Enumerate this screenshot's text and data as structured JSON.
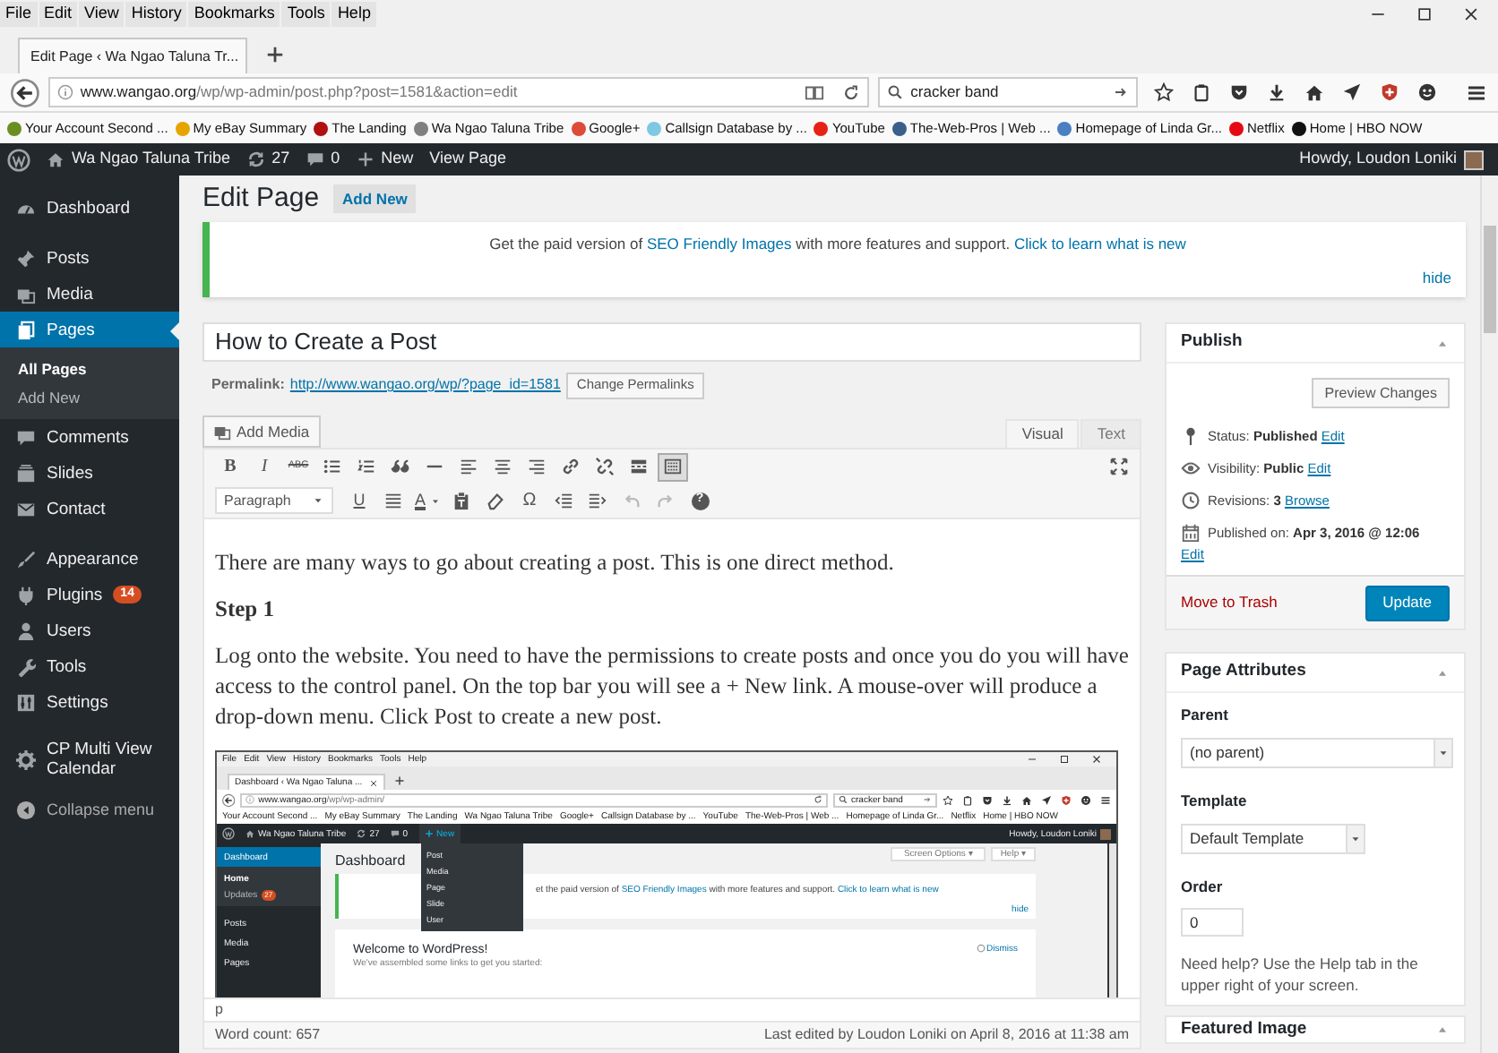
{
  "menu_bar": [
    "File",
    "Edit",
    "View",
    "History",
    "Bookmarks",
    "Tools",
    "Help"
  ],
  "browser_tab": {
    "title": "Edit Page ‹ Wa Ngao Taluna Tr..."
  },
  "address_bar": {
    "domain": "www.wangao.org",
    "path": "/wp/wp-admin/post.php?post=1581&action=edit"
  },
  "search_field": {
    "value": "cracker band"
  },
  "bookmarks": [
    {
      "label": "Your Account Second ...",
      "color": "#6b8e23"
    },
    {
      "label": "My eBay Summary",
      "color": "#e6a400"
    },
    {
      "label": "The Landing",
      "color": "#b01010"
    },
    {
      "label": "Wa Ngao Taluna Tribe",
      "color": "#808080"
    },
    {
      "label": "Google+",
      "color": "#dd4b39"
    },
    {
      "label": "Callsign Database by ...",
      "color": "#7ec8e3"
    },
    {
      "label": "YouTube",
      "color": "#e62117"
    },
    {
      "label": "The-Web-Pros | Web ...",
      "color": "#3a5f8a"
    },
    {
      "label": "Homepage of Linda Gr...",
      "color": "#4a7fc1"
    },
    {
      "label": "Netflix",
      "color": "#e50914"
    },
    {
      "label": "Home | HBO NOW",
      "color": "#111111"
    }
  ],
  "admin_bar": {
    "site": "Wa Ngao Taluna Tribe",
    "updates": "27",
    "comments": "0",
    "new": "New",
    "view": "View Page",
    "greeting": "Howdy, Loudon Loniki"
  },
  "sidebar": {
    "groups": [
      {
        "items": [
          {
            "kind": "dashboard",
            "label": "Dashboard",
            "selected": false
          }
        ]
      },
      {
        "items": [
          {
            "kind": "posts",
            "label": "Posts",
            "selected": false
          },
          {
            "kind": "media",
            "label": "Media",
            "selected": false
          },
          {
            "kind": "pages",
            "label": "Pages",
            "selected": true,
            "children": [
              {
                "label": "All Pages",
                "selected": true
              },
              {
                "label": "Add New",
                "selected": false
              }
            ]
          },
          {
            "kind": "comments",
            "label": "Comments",
            "selected": false
          },
          {
            "kind": "slides",
            "label": "Slides",
            "selected": false
          },
          {
            "kind": "contact",
            "label": "Contact",
            "selected": false
          }
        ]
      },
      {
        "items": [
          {
            "kind": "appearance",
            "label": "Appearance",
            "selected": false
          },
          {
            "kind": "plugins",
            "label": "Plugins",
            "selected": false,
            "badge": "14"
          },
          {
            "kind": "users",
            "label": "Users",
            "selected": false
          },
          {
            "kind": "tools",
            "label": "Tools",
            "selected": false
          },
          {
            "kind": "settings",
            "label": "Settings",
            "selected": false
          }
        ]
      },
      {
        "items": [
          {
            "kind": "calendar",
            "label": "CP Multi View Calendar",
            "selected": false
          }
        ]
      }
    ],
    "collapse": "Collapse menu"
  },
  "heading": "Edit Page",
  "add_new": "Add New",
  "notice": {
    "text": "Get the paid version of ",
    "link": "SEO Friendly Images",
    "text_2": " with more features and support. ",
    "link_2": "Click to learn what is new",
    "hide": "hide"
  },
  "title_field": {
    "value": "How to Create a Post"
  },
  "permalink": {
    "label": "Permalink:",
    "url": "http://www.wangao.org/wp/?page_id=1581",
    "button": "Change Permalinks"
  },
  "add_media": "Add Media",
  "editor_tabs": [
    {
      "label": "Visual",
      "selected": true
    },
    {
      "label": "Text",
      "selected": false
    }
  ],
  "toolbar": {
    "row_1": [
      {
        "kind": "bold",
        "glyph": "B"
      },
      {
        "kind": "italic",
        "glyph": "I"
      },
      {
        "kind": "strike",
        "glyph": "ABC"
      },
      {
        "kind": "bullets"
      },
      {
        "kind": "numbers"
      },
      {
        "kind": "quote"
      },
      {
        "kind": "hr"
      },
      {
        "kind": "align-left"
      },
      {
        "kind": "align-center"
      },
      {
        "kind": "align-right"
      },
      {
        "kind": "link"
      },
      {
        "kind": "unlink"
      },
      {
        "kind": "more"
      },
      {
        "kind": "toggle",
        "selected": true
      }
    ],
    "row_2": [
      {
        "kind": "format",
        "value": "Paragraph"
      },
      {
        "kind": "underline",
        "glyph": "U"
      },
      {
        "kind": "justify"
      },
      {
        "kind": "color",
        "glyph": "A"
      },
      {
        "kind": "paste"
      },
      {
        "kind": "eraser"
      },
      {
        "kind": "omega",
        "glyph": "Ω"
      },
      {
        "kind": "outdent"
      },
      {
        "kind": "indent"
      },
      {
        "kind": "undo"
      },
      {
        "kind": "redo"
      },
      {
        "kind": "help",
        "glyph": "?"
      }
    ]
  },
  "content": [
    {
      "kind": "p",
      "text": "There are many ways to go about creating a post. This is one direct method."
    },
    {
      "kind": "h",
      "text": "Step 1"
    },
    {
      "kind": "p",
      "text": "Log onto the website. You need to have the permissions to create posts and once you do you will have access to the control panel. On the top bar you will see a + New link. A mouse-over will produce a drop-down menu. Click Post to create a new post."
    }
  ],
  "inner_screenshot": {
    "menu_bar": [
      "File",
      "Edit",
      "View",
      "History",
      "Bookmarks",
      "Tools",
      "Help"
    ],
    "tab": "Dashboard ‹ Wa Ngao Taluna ...",
    "url_domain": "www.wangao.org",
    "url_path": "/wp/wp-admin/",
    "search": "cracker band",
    "bookmarks": [
      "Your Account Second ...",
      "My eBay Summary",
      "The Landing",
      "Wa Ngao Taluna Tribe",
      "Google+",
      "Callsign Database by ...",
      "YouTube",
      "The-Web-Pros | Web ...",
      "Homepage of Linda Gr...",
      "Netflix",
      "Home | HBO NOW"
    ],
    "admin_bar": {
      "site": "Wa Ngao Taluna Tribe",
      "updates": "27",
      "comments": "0",
      "new": "New",
      "greeting": "Howdy, Loudon Loniki"
    },
    "sidebar": [
      {
        "label": "Dashboard",
        "selected": true,
        "children": [
          {
            "label": "Home",
            "selected": true
          },
          {
            "label": "Updates",
            "selected": false,
            "badge": "27"
          }
        ]
      },
      {
        "label": "Posts",
        "selected": false
      },
      {
        "label": "Media",
        "selected": false
      },
      {
        "label": "Pages",
        "selected": false
      }
    ],
    "new_menu": [
      "Post",
      "Media",
      "Page",
      "Slide",
      "User"
    ],
    "heading": "Dashboard",
    "screen_options": "Screen Options ▾",
    "help": "Help ▾",
    "notice": {
      "text": "et the paid version of ",
      "link": "SEO Friendly Images",
      "text_2": " with more features and support. ",
      "link_2": "Click to learn what is new",
      "hide": "hide"
    },
    "welcome": "Welcome to WordPress!",
    "welcome_sub": "We've assembled some links to get you started:",
    "dismiss": "Dismiss"
  },
  "path": "p",
  "word_count": "Word count: 657",
  "last_edited": "Last edited by Loudon Loniki on April 8, 2016 at 11:38 am",
  "publish": {
    "title": "Publish",
    "preview": "Preview Changes",
    "rows": [
      {
        "kind": "status",
        "label": "Status: ",
        "value": "Published",
        "link": "Edit"
      },
      {
        "kind": "visibility",
        "label": "Visibility: ",
        "value": "Public",
        "link": "Edit"
      },
      {
        "kind": "revisions",
        "label": "Revisions: ",
        "value": "3",
        "link": "Browse"
      },
      {
        "kind": "published",
        "label": "Published on: ",
        "value": "Apr 3, 2016 @ 12:06",
        "link": "Edit"
      }
    ],
    "trash": "Move to Trash",
    "update": "Update"
  },
  "page_attributes": {
    "title": "Page Attributes",
    "parent_label": "Parent",
    "parent": "(no parent)",
    "template_label": "Template",
    "template": "Default Template",
    "order_label": "Order",
    "order": "0",
    "help": "Need help? Use the Help tab in the upper right of your screen."
  },
  "featured_image": {
    "title": "Featured Image"
  }
}
